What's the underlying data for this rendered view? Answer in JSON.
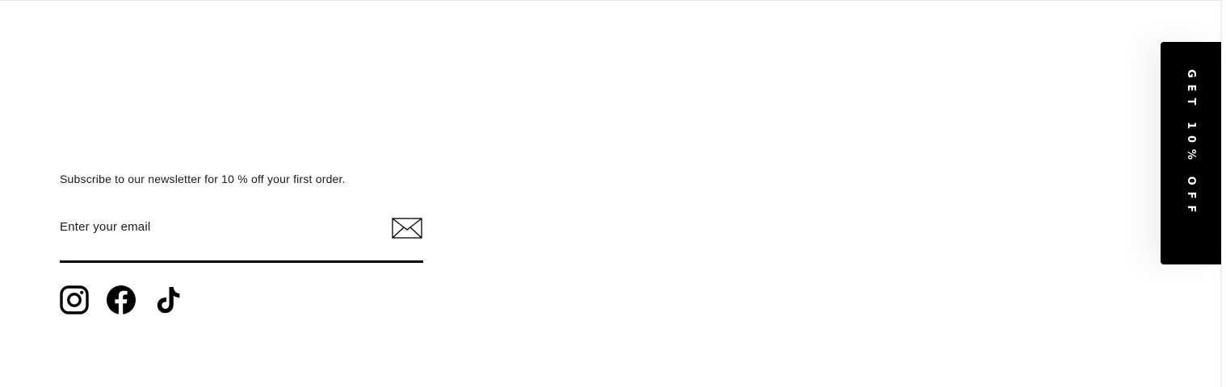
{
  "newsletter": {
    "text": "Subscribe to our newsletter for 10 % off your first order.",
    "email_placeholder": "Enter your email",
    "submit_icon": "envelope-icon"
  },
  "social": {
    "links": [
      {
        "name": "Instagram",
        "icon": "instagram-icon"
      },
      {
        "name": "Facebook",
        "icon": "facebook-icon"
      },
      {
        "name": "TikTok",
        "icon": "tiktok-icon"
      }
    ]
  },
  "promo_tab": {
    "label": "GET 10% OFF",
    "background": "#000000",
    "text_color": "#ffffff"
  }
}
